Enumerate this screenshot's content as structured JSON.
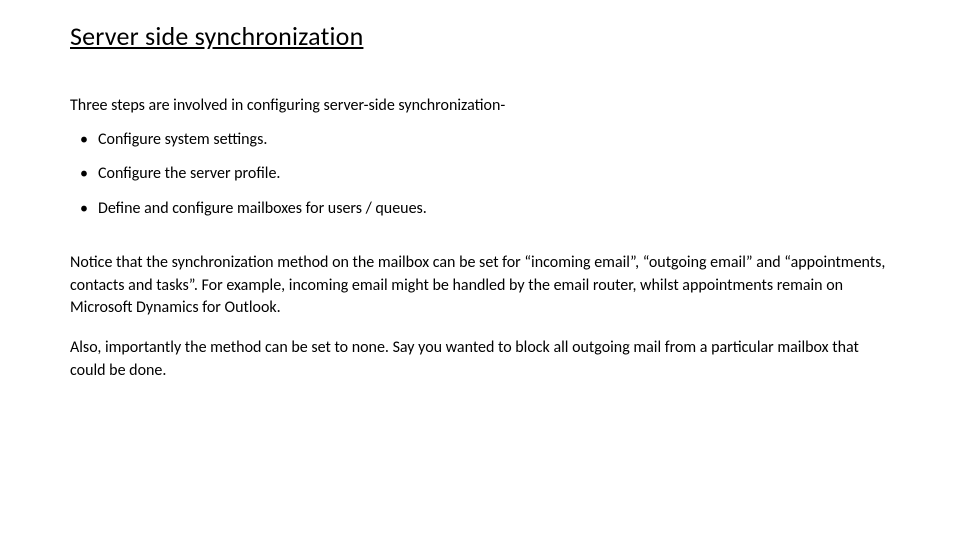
{
  "title": "Server side synchronization",
  "intro": "Three steps are involved in configuring server-side synchronization-",
  "bullets": [
    "Configure system settings.",
    "Configure the server profile.",
    "Define and configure mailboxes for users / queues."
  ],
  "para1": "Notice that the synchronization method on the mailbox can be set for “incoming email”, “outgoing email” and “appointments, contacts and tasks”. For example, incoming email might be handled by the email router, whilst appointments remain on Microsoft Dynamics for Outlook.",
  "para2": "Also, importantly the method can be set to none. Say you wanted to block all outgoing mail from a particular mailbox that could be done."
}
